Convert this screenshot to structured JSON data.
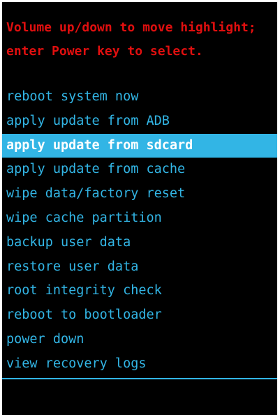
{
  "colors": {
    "background": "#000000",
    "header_text": "#e00f0f",
    "item_text": "#32b5e5",
    "selected_background": "#32b5e5",
    "selected_text": "#ffffff"
  },
  "header": {
    "line1": "Volume up/down to move highlight;",
    "line2": "enter Power key to select."
  },
  "menu": {
    "selected_index": 2,
    "items": [
      {
        "label": "reboot system now"
      },
      {
        "label": "apply update from ADB"
      },
      {
        "label": "apply update from sdcard"
      },
      {
        "label": "apply update from cache"
      },
      {
        "label": "wipe data/factory reset"
      },
      {
        "label": "wipe cache partition"
      },
      {
        "label": "backup user data"
      },
      {
        "label": "restore user data"
      },
      {
        "label": "root integrity check"
      },
      {
        "label": "reboot to bootloader"
      },
      {
        "label": "power down"
      },
      {
        "label": "view recovery logs"
      }
    ]
  }
}
